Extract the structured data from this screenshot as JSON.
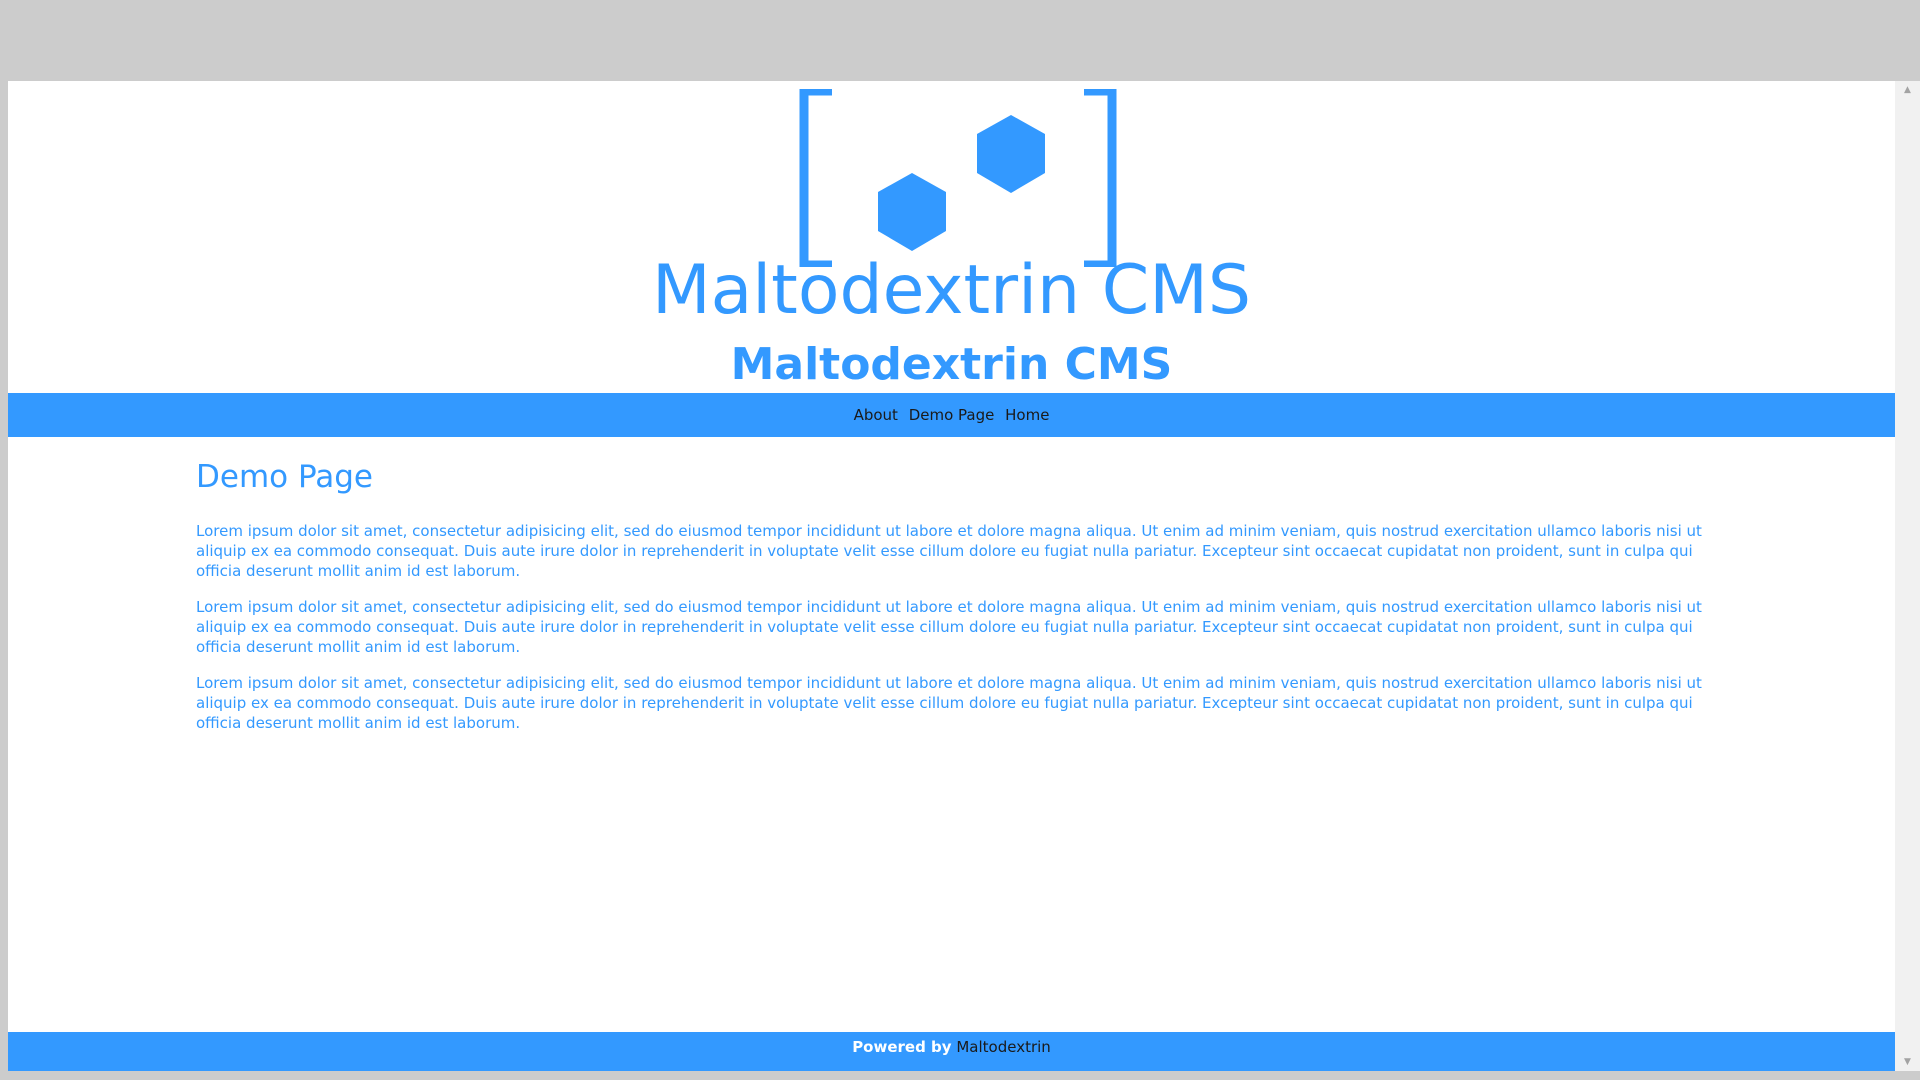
{
  "colors": {
    "brand": "#3399ff",
    "nav_text": "#1a1a1a",
    "background": "#ffffff",
    "chrome": "#cccccc"
  },
  "header": {
    "logo_icon": "bracketed-hexagons-logo",
    "title_large": "Maltodextrin CMS",
    "title_small": "Maltodextrin CMS"
  },
  "nav": {
    "items": [
      {
        "label": "About"
      },
      {
        "label": "Demo Page"
      },
      {
        "label": "Home"
      }
    ]
  },
  "main": {
    "heading": "Demo Page",
    "paragraphs": [
      "Lorem ipsum dolor sit amet, consectetur adipisicing elit, sed do eiusmod tempor incididunt ut labore et dolore magna aliqua. Ut enim ad minim veniam, quis nostrud exercitation ullamco laboris nisi ut aliquip ex ea commodo consequat. Duis aute irure dolor in reprehenderit in voluptate velit esse cillum dolore eu fugiat nulla pariatur. Excepteur sint occaecat cupidatat non proident, sunt in culpa qui officia deserunt mollit anim id est laborum.",
      "Lorem ipsum dolor sit amet, consectetur adipisicing elit, sed do eiusmod tempor incididunt ut labore et dolore magna aliqua. Ut enim ad minim veniam, quis nostrud exercitation ullamco laboris nisi ut aliquip ex ea commodo consequat. Duis aute irure dolor in reprehenderit in voluptate velit esse cillum dolore eu fugiat nulla pariatur. Excepteur sint occaecat cupidatat non proident, sunt in culpa qui officia deserunt mollit anim id est laborum.",
      "Lorem ipsum dolor sit amet, consectetur adipisicing elit, sed do eiusmod tempor incididunt ut labore et dolore magna aliqua. Ut enim ad minim veniam, quis nostrud exercitation ullamco laboris nisi ut aliquip ex ea commodo consequat. Duis aute irure dolor in reprehenderit in voluptate velit esse cillum dolore eu fugiat nulla pariatur. Excepteur sint occaecat cupidatat non proident, sunt in culpa qui officia deserunt mollit anim id est laborum."
    ]
  },
  "footer": {
    "powered_by": "Powered by",
    "link_label": "Maltodextrin"
  },
  "scrollbar": {
    "up_icon": "arrow-up-icon",
    "down_icon": "arrow-down-icon"
  }
}
